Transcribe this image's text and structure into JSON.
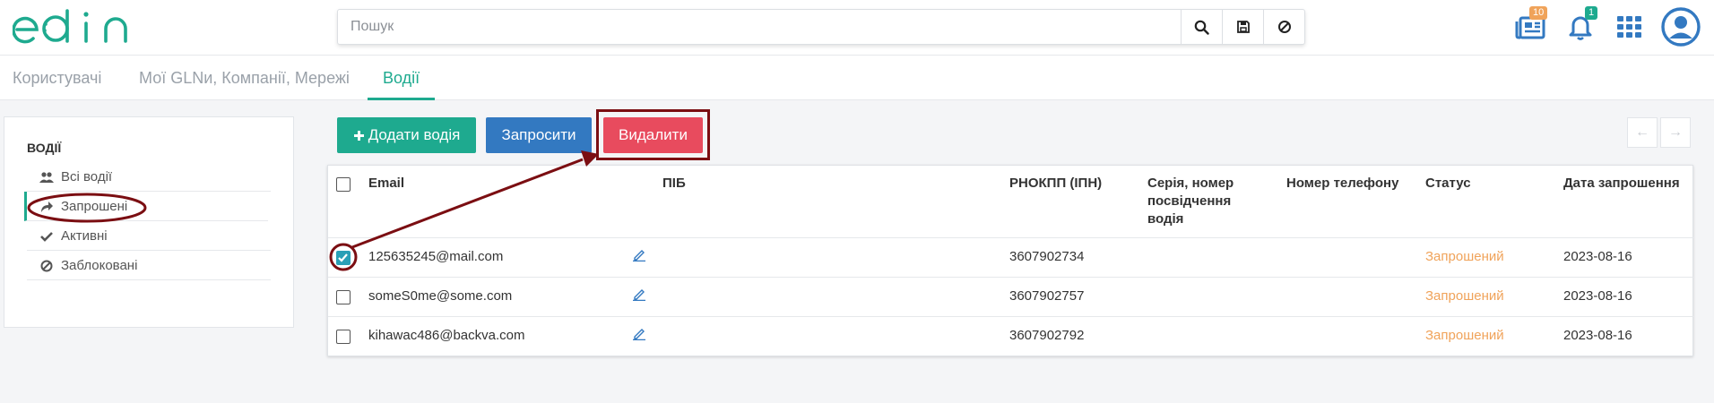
{
  "header": {
    "search_placeholder": "Пошук",
    "docs_badge": "10",
    "notif_badge": "1"
  },
  "tabs": [
    {
      "label": "Користувачі"
    },
    {
      "label": "Мої GLNи, Компанії, Мережі"
    },
    {
      "label": "Водії"
    }
  ],
  "sidebar": {
    "title": "ВОДІЇ",
    "items": [
      {
        "label": "Всі водії",
        "icon": "users-icon"
      },
      {
        "label": "Запрошені",
        "icon": "share-icon"
      },
      {
        "label": "Активні",
        "icon": "check-icon"
      },
      {
        "label": "Заблоковані",
        "icon": "ban-icon"
      }
    ]
  },
  "toolbar": {
    "add_label": "Додати водія",
    "invite_label": "Запросити",
    "delete_label": "Видалити"
  },
  "table": {
    "headers": {
      "email": "Email",
      "name": "ПІБ",
      "tax": "РНОКПП (ІПН)",
      "license": "Серія, номер посвідчення водія",
      "phone": "Номер телефону",
      "status": "Статус",
      "invite_date": "Дата запрошення"
    },
    "rows": [
      {
        "email": "125635245@mail.com",
        "tax": "3607902734",
        "status": "Запрошений",
        "date": "2023-08-16",
        "checked": true
      },
      {
        "email": "someS0me@some.com",
        "tax": "3607902757",
        "status": "Запрошений",
        "date": "2023-08-16",
        "checked": false
      },
      {
        "email": "kihawac486@backva.com",
        "tax": "3607902792",
        "status": "Запрошений",
        "date": "2023-08-16",
        "checked": false
      }
    ]
  },
  "colors": {
    "accent": "#1eaa8f",
    "primary": "#3379c1",
    "danger": "#e84b5e",
    "status_invited": "#f0a35a",
    "annotation": "#7b0e12"
  }
}
